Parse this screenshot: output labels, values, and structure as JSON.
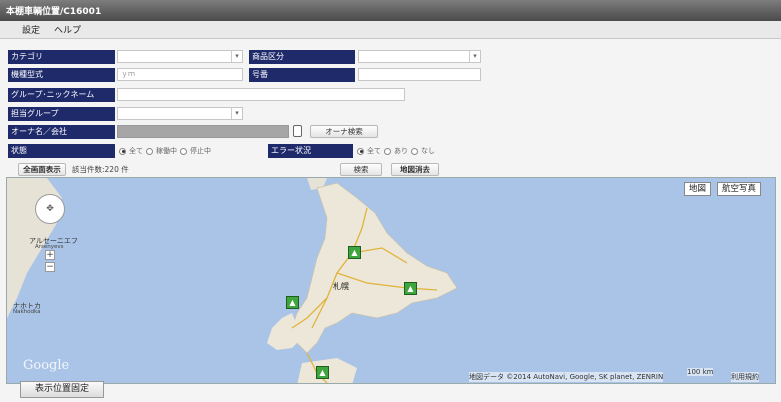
{
  "window": {
    "title": "本棚車輌位置/C16001"
  },
  "menu": {
    "settings": "設定",
    "help": "ヘルプ"
  },
  "form": {
    "category_label": "カテゴリ",
    "product_label": "商品区分",
    "model_label": "機種型式",
    "model_value": "ｙｍ",
    "serial_label": "号番",
    "group_nick_label": "グループ･ニックネーム",
    "group_label": "担当グループ",
    "owner_label": "オーナ名／会社",
    "owner_search": "オーナ検索",
    "status_label": "状態",
    "status_options": [
      "全て",
      "稼働中",
      "停止中"
    ],
    "error_label": "エラー状況",
    "error_options": [
      "全て",
      "あり",
      "なし"
    ],
    "full_display_btn": "全画面表示",
    "count_text": "該当件数:220 件",
    "search_btn": "検索",
    "clear_btn": "地図消去"
  },
  "map": {
    "type_map": "地図",
    "type_sat": "航空写真",
    "place_sapporo": "札幌",
    "place_arseniev": "アルセーニエフ",
    "place_arseniev_en": "Arsenyevs",
    "place_nakhodka": "ナホトカ",
    "place_nakhodka_en": "Nakhodka",
    "logo": "Google",
    "attribution": "地図データ ©2014 AutoNavi, Google, SK planet, ZENRIN",
    "scale": "100 km",
    "terms": "利用規約"
  },
  "footer": {
    "fix_position": "表示位置固定"
  }
}
